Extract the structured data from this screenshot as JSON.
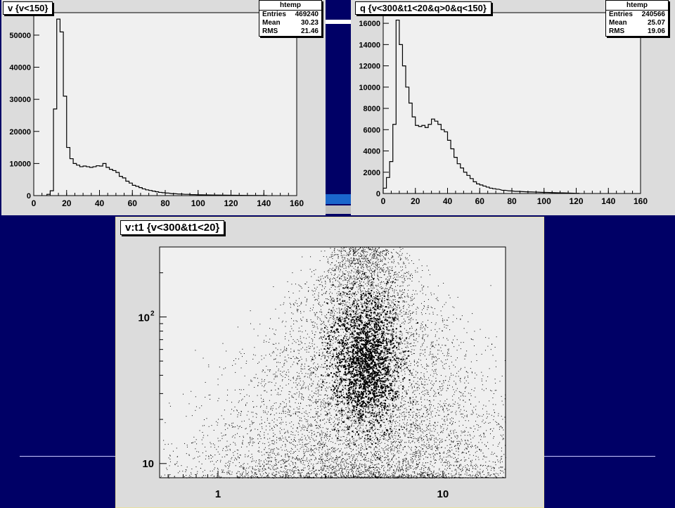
{
  "plots": {
    "left": {
      "title": "v {v<150}",
      "stats": {
        "name": "htemp",
        "rows": [
          {
            "label": "Entries",
            "value": "469240"
          },
          {
            "label": "Mean",
            "value": "30.23"
          },
          {
            "label": "RMS",
            "value": "21.46"
          }
        ]
      }
    },
    "right": {
      "title": "q {v<300&t1<20&q>0&q<150}",
      "stats": {
        "name": "htemp",
        "rows": [
          {
            "label": "Entries",
            "value": "240566"
          },
          {
            "label": "Mean",
            "value": "25.07"
          },
          {
            "label": "RMS",
            "value": "19.06"
          }
        ]
      }
    },
    "bottom": {
      "title": "v:t1 {v<300&t1<20}"
    }
  },
  "chart_data": [
    {
      "type": "histogram",
      "xlim": [
        0,
        160
      ],
      "ylim": [
        0,
        57000
      ],
      "xticks": [
        0,
        20,
        40,
        60,
        80,
        100,
        120,
        140,
        160
      ],
      "yticks": [
        0,
        10000,
        20000,
        30000,
        40000,
        50000
      ],
      "bin_width": 2,
      "x": [
        8,
        10,
        12,
        14,
        16,
        18,
        20,
        22,
        24,
        26,
        28,
        30,
        32,
        34,
        36,
        38,
        40,
        42,
        44,
        46,
        48,
        50,
        52,
        54,
        56,
        58,
        60,
        62,
        64,
        66,
        68,
        70,
        72,
        74,
        76,
        78,
        80,
        84,
        88,
        92,
        96,
        100,
        110,
        120,
        130,
        140
      ],
      "values": [
        400,
        1500,
        27000,
        55000,
        51000,
        31000,
        15000,
        11500,
        10000,
        9500,
        9000,
        9200,
        9000,
        8800,
        9000,
        9300,
        9200,
        10000,
        8800,
        8200,
        7800,
        7200,
        6000,
        5500,
        4500,
        3900,
        3200,
        2900,
        2500,
        2100,
        1800,
        1600,
        1400,
        1200,
        1000,
        900,
        800,
        600,
        500,
        400,
        300,
        250,
        180,
        120,
        60,
        20
      ]
    },
    {
      "type": "histogram",
      "xlim": [
        0,
        160
      ],
      "ylim": [
        0,
        17000
      ],
      "xticks": [
        0,
        20,
        40,
        60,
        80,
        100,
        120,
        140,
        160
      ],
      "yticks": [
        0,
        2000,
        4000,
        6000,
        8000,
        10000,
        12000,
        14000,
        16000
      ],
      "bin_width": 2,
      "x": [
        0,
        2,
        4,
        6,
        8,
        10,
        12,
        14,
        16,
        18,
        20,
        22,
        24,
        26,
        28,
        30,
        32,
        34,
        36,
        38,
        40,
        42,
        44,
        46,
        48,
        50,
        52,
        54,
        56,
        58,
        60,
        62,
        64,
        66,
        68,
        70,
        74,
        78,
        82,
        90,
        100,
        110,
        120
      ],
      "values": [
        500,
        1500,
        3000,
        6500,
        16300,
        14000,
        12000,
        10000,
        8500,
        7200,
        6400,
        6300,
        6400,
        6200,
        6500,
        7000,
        6800,
        6500,
        6000,
        5800,
        5000,
        4200,
        3400,
        2800,
        2400,
        2000,
        1700,
        1400,
        1100,
        900,
        800,
        700,
        600,
        500,
        450,
        400,
        300,
        250,
        200,
        150,
        100,
        60,
        20
      ]
    },
    {
      "type": "scatter",
      "xscale": "log",
      "yscale": "log",
      "xlim": [
        0.55,
        19
      ],
      "ylim": [
        8,
        300
      ],
      "xtick_labels": [
        "1",
        "10"
      ],
      "ytick_labels": [
        "10",
        "10",
        "2"
      ],
      "ytick_values": [
        10,
        100
      ],
      "description_cluster_center": [
        4.5,
        50
      ]
    }
  ]
}
